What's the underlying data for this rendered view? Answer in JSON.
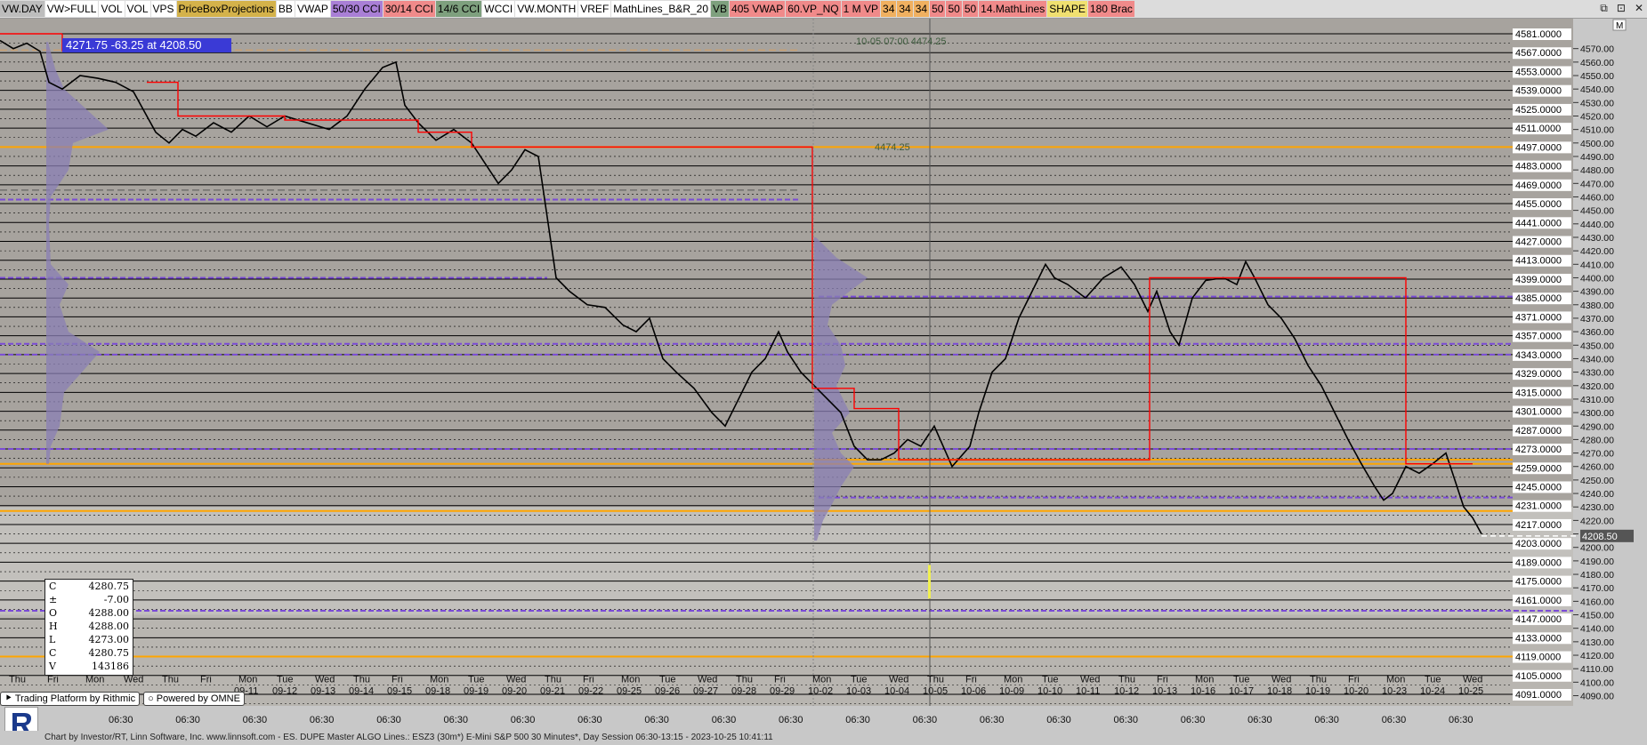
{
  "toolbar": {
    "items": [
      {
        "label": "VW.DAY",
        "bg": "#bdbdbd"
      },
      {
        "label": "VW>FULL",
        "bg": "#ffffff"
      },
      {
        "label": "VOL",
        "bg": "#ffffff"
      },
      {
        "label": "VOL",
        "bg": "#ffffff"
      },
      {
        "label": "VPS",
        "bg": "#ffffff"
      },
      {
        "label": "PriceBoxProjections",
        "bg": "#d4b24a"
      },
      {
        "label": "BB",
        "bg": "#ffffff"
      },
      {
        "label": "VWAP",
        "bg": "#ffffff"
      },
      {
        "label": "50/30 CCI",
        "bg": "#a97fd6"
      },
      {
        "label": "30/14 CCI",
        "bg": "#f08a8a"
      },
      {
        "label": "14/6 CCI",
        "bg": "#7ea07e"
      },
      {
        "label": "WCCI",
        "bg": "#ffffff"
      },
      {
        "label": "VW.MONTH",
        "bg": "#ffffff"
      },
      {
        "label": "VREF",
        "bg": "#ffffff"
      },
      {
        "label": "MathLines_B&R_20",
        "bg": "#ffffff"
      },
      {
        "label": "VB",
        "bg": "#7ea07e"
      },
      {
        "label": "405 VWAP",
        "bg": "#f08a8a"
      },
      {
        "label": "60.VP_NQ",
        "bg": "#f08a8a"
      },
      {
        "label": "1 M VP",
        "bg": "#f08a8a"
      },
      {
        "label": "34",
        "bg": "#f0b060"
      },
      {
        "label": "34",
        "bg": "#f0b060"
      },
      {
        "label": "34",
        "bg": "#f0b060"
      },
      {
        "label": "50",
        "bg": "#f08a8a"
      },
      {
        "label": "50",
        "bg": "#f08a8a"
      },
      {
        "label": "50",
        "bg": "#f08a8a"
      },
      {
        "label": "14.MathLines",
        "bg": "#f08a8a"
      },
      {
        "label": "SHAPE",
        "bg": "#f0e070"
      },
      {
        "label": "180 Brac",
        "bg": "#f08a8a"
      }
    ],
    "window_controls": [
      "⧉",
      "⊡",
      "✕"
    ]
  },
  "chart": {
    "info_label": "-63.25 at 4208.50",
    "info_label_prefix": "4271.75",
    "annotation_1": "10-05 07:00  4474.25",
    "annotation_2": "4474.25",
    "current_price": "4208.50",
    "m_button": "M",
    "price_labels": [
      "4581.0000",
      "4567.0000",
      "4553.0000",
      "4539.0000",
      "4525.0000",
      "4511.0000",
      "4497.0000",
      "4483.0000",
      "4469.0000",
      "4455.0000",
      "4441.0000",
      "4427.0000",
      "4413.0000",
      "4399.0000",
      "4385.0000",
      "4371.0000",
      "4357.0000",
      "4343.0000",
      "4329.0000",
      "4315.0000",
      "4301.0000",
      "4287.0000",
      "4273.0000",
      "4259.0000",
      "4245.0000",
      "4231.0000",
      "4217.0000",
      "4203.0000",
      "4189.0000",
      "4175.0000",
      "4161.0000",
      "4147.0000",
      "4133.0000",
      "4119.0000",
      "4105.0000",
      "4091.0000"
    ],
    "axis_ticks": [
      "4570.00",
      "4560.00",
      "4550.00",
      "4540.00",
      "4530.00",
      "4520.00",
      "4510.00",
      "4500.00",
      "4490.00",
      "4480.00",
      "4470.00",
      "4460.00",
      "4450.00",
      "4440.00",
      "4430.00",
      "4420.00",
      "4410.00",
      "4400.00",
      "4390.00",
      "4380.00",
      "4370.00",
      "4360.00",
      "4350.00",
      "4340.00",
      "4330.00",
      "4320.00",
      "4310.00",
      "4300.00",
      "4290.00",
      "4280.00",
      "4270.00",
      "4260.00",
      "4250.00",
      "4240.00",
      "4230.00",
      "4220.00",
      "4210.00",
      "4200.00",
      "4190.00",
      "4180.00",
      "4170.00",
      "4160.00",
      "4150.00",
      "4140.00",
      "4130.00",
      "4120.00",
      "4110.00",
      "4100.00",
      "4090.00"
    ],
    "date_labels": [
      {
        "day": "Thu",
        "date": ""
      },
      {
        "day": "Fri",
        "date": ""
      },
      {
        "day": "Mon",
        "date": ""
      },
      {
        "day": "Wed",
        "date": ""
      },
      {
        "day": "Thu",
        "date": ""
      },
      {
        "day": "Fri",
        "date": ""
      },
      {
        "day": "Mon",
        "date": "09-11"
      },
      {
        "day": "Tue",
        "date": "09-12"
      },
      {
        "day": "Wed",
        "date": "09-13"
      },
      {
        "day": "Thu",
        "date": "09-14"
      },
      {
        "day": "Fri",
        "date": "09-15"
      },
      {
        "day": "Mon",
        "date": "09-18"
      },
      {
        "day": "Tue",
        "date": "09-19"
      },
      {
        "day": "Wed",
        "date": "09-20"
      },
      {
        "day": "Thu",
        "date": "09-21"
      },
      {
        "day": "Fri",
        "date": "09-22"
      },
      {
        "day": "Mon",
        "date": "09-25"
      },
      {
        "day": "Tue",
        "date": "09-26"
      },
      {
        "day": "Wed",
        "date": "09-27"
      },
      {
        "day": "Thu",
        "date": "09-28"
      },
      {
        "day": "Fri",
        "date": "09-29"
      },
      {
        "day": "Mon",
        "date": "10-02"
      },
      {
        "day": "Tue",
        "date": "10-03"
      },
      {
        "day": "Wed",
        "date": "10-04"
      },
      {
        "day": "Thu",
        "date": "10-05"
      },
      {
        "day": "Fri",
        "date": "10-06"
      },
      {
        "day": "Mon",
        "date": "10-09"
      },
      {
        "day": "Tue",
        "date": "10-10"
      },
      {
        "day": "Wed",
        "date": "10-11"
      },
      {
        "day": "Thu",
        "date": "10-12"
      },
      {
        "day": "Fri",
        "date": "10-13"
      },
      {
        "day": "Mon",
        "date": "10-16"
      },
      {
        "day": "Tue",
        "date": "10-17"
      },
      {
        "day": "Wed",
        "date": "10-18"
      },
      {
        "day": "Thu",
        "date": "10-19"
      },
      {
        "day": "Fri",
        "date": "10-20"
      },
      {
        "day": "Mon",
        "date": "10-23"
      },
      {
        "day": "Tue",
        "date": "10-24"
      },
      {
        "day": "Wed",
        "date": "10-25"
      }
    ],
    "time_labels": [
      "06:30",
      "06:30",
      "06:30",
      "06:30",
      "06:30",
      "06:30",
      "06:30",
      "06:30",
      "06:30",
      "06:30",
      "06:30",
      "06:30",
      "06:30",
      "06:30",
      "06:30",
      "06:30",
      "06:30",
      "06:30",
      "06:30",
      "06:30",
      "06:30"
    ],
    "colors": {
      "bg": "#a7a39e",
      "grid": "#000000",
      "red_line": "#ff0000",
      "orange_line": "#ffa500",
      "purple_line": "#7a4bd6",
      "price_label_bg": "#ffffff"
    }
  },
  "ohlc": {
    "rows": [
      {
        "k": "C",
        "v": "4280.75"
      },
      {
        "k": "±",
        "v": "-7.00"
      },
      {
        "k": "O",
        "v": "4288.00"
      },
      {
        "k": "H",
        "v": "4288.00"
      },
      {
        "k": "L",
        "v": "4273.00"
      },
      {
        "k": "C",
        "v": "4280.75"
      },
      {
        "k": "V",
        "v": "143186"
      }
    ]
  },
  "branding": {
    "rithmic": "Trading Platform by Rithmic",
    "omne": "Powered by OMNE"
  },
  "footer": {
    "text": "Chart by Investor/RT, Linn Software, Inc. www.linnsoft.com - ES. DUPE Master ALGO Lines.: ESZ3 (30m*) E-Mini S&P 500 30 Minutes*, Day Session 06:30-13:15 - 2023-10-25 10:41:11"
  }
}
